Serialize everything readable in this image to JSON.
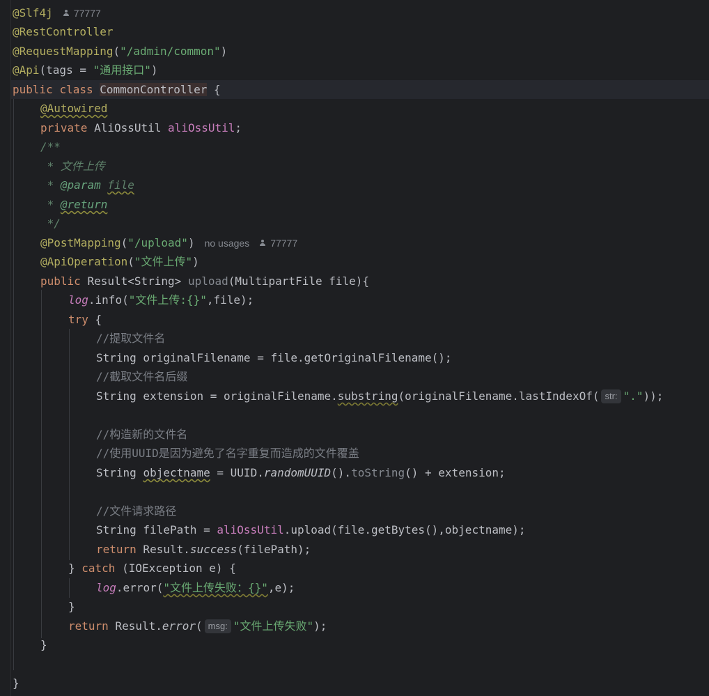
{
  "editor": {
    "file_author": "77777",
    "lines": {
      "slf4j": "@Slf4j",
      "rest_controller": "@RestController",
      "request_mapping_annot": "@RequestMapping",
      "request_mapping_path": "\"/admin/common\"",
      "api_annot": "@Api",
      "api_tags_prefix": "(tags = ",
      "api_tags_value": "\"通用接口\"",
      "class_public": "public",
      "class_kw": "class",
      "class_name": "CommonController",
      "autowired": "@Autowired",
      "field_private": "private",
      "field_type": "AliOssUtil",
      "field_name": "aliOssUtil",
      "doc_open": "/**",
      "doc_desc": "* 文件上传",
      "doc_param_tag": "@param",
      "doc_param_name": "file",
      "doc_return_tag": "@return",
      "doc_close": "*/",
      "post_mapping_annot": "@PostMapping",
      "post_mapping_path": "\"/upload\"",
      "no_usages": "no usages",
      "api_operation_annot": "@ApiOperation",
      "api_operation_value": "\"文件上传\"",
      "method_public": "public",
      "method_return": "Result<String>",
      "method_name": "upload",
      "method_params": "(MultipartFile file){",
      "log_info_obj": "log",
      "log_info_call": ".info(",
      "log_info_str": "\"文件上传:{}\"",
      "log_info_tail": ",file);",
      "try_kw": "try",
      "cmt_extract_name": "//提取文件名",
      "original_filename_stmt": "String originalFilename = file.getOriginalFilename();",
      "cmt_extract_suffix": "//截取文件名后缀",
      "ext_prefix": "String extension = originalFilename.",
      "ext_substring": "substring",
      "ext_mid": "(originalFilename.lastIndexOf(",
      "hint_str": "str:",
      "ext_dot": "\".\"",
      "ext_tail": "));",
      "cmt_build_name": "//构造新的文件名",
      "cmt_uuid_reason": "//使用UUID是因为避免了名字重复而造成的文件覆盖",
      "obj_prefix": "String ",
      "obj_var": "objectname",
      "obj_mid": " = UUID.",
      "obj_random": "randomUUID",
      "obj_paren": "().",
      "obj_tostring": "toString",
      "obj_tail": "() + extension;",
      "cmt_request_path": "//文件请求路径",
      "filepath_prefix": "String filePath = ",
      "filepath_field": "aliOssUtil",
      "filepath_tail": ".upload(file.getBytes(),objectname);",
      "return_kw": "return",
      "return_success_prefix": " Result.",
      "return_success_fn": "success",
      "return_success_tail": "(filePath);",
      "catch_open": "} ",
      "catch_kw": "catch",
      "catch_tail": " (IOException e) {",
      "log_error_obj": "log",
      "log_error_call": ".error(",
      "log_error_str": "\"文件上传失败：{}\"",
      "log_error_tail": ",e);",
      "close_brace": "}",
      "return_error_prefix": " Result.",
      "return_error_fn": "error",
      "hint_msg": "msg:",
      "return_error_str": "\"文件上传失败\"",
      "return_error_tail": ");"
    }
  },
  "colors": {
    "background": "#1e1f22",
    "annotation": "#b3ae60",
    "keyword": "#cf8e6d",
    "string": "#6aab73",
    "field": "#c77dbb",
    "comment": "#7a7e85",
    "doc_comment": "#5f826b"
  },
  "icons": {
    "author_hint": "user-icon"
  }
}
